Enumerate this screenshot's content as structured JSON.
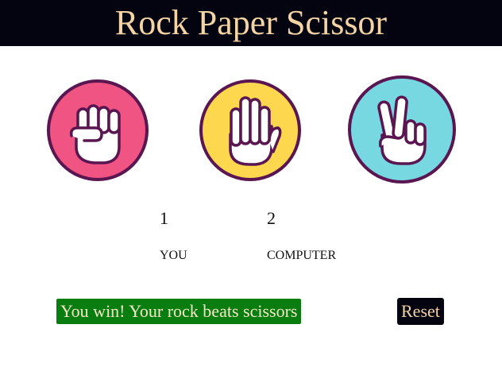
{
  "header": {
    "title": "Rock Paper Scissor"
  },
  "choices": [
    {
      "name": "rock",
      "icon": "fist-icon",
      "color": "#ef5482"
    },
    {
      "name": "paper",
      "icon": "open-hand-icon",
      "color": "#fdd74d"
    },
    {
      "name": "scissor",
      "icon": "victory-hand-icon",
      "color": "#78d8e2"
    }
  ],
  "border_color": "#5a1650",
  "scoreboard": {
    "user_score": "1",
    "user_label": "YOU",
    "computer_score": "2",
    "computer_label": "COMPUTER"
  },
  "message": {
    "text": "You win! Your rock beats scissors",
    "color": "#0a7d10"
  },
  "reset_label": "Reset"
}
